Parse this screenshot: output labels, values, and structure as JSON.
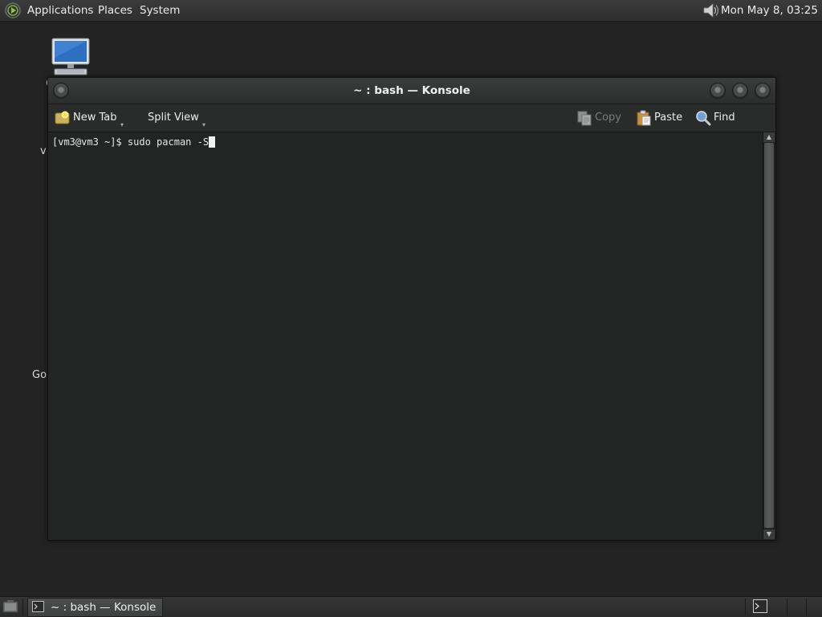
{
  "top_panel": {
    "menus": [
      "Applications",
      "Places",
      "System"
    ],
    "clock": "Mon May  8, 03:25"
  },
  "desktop": {
    "icon_partial_labels": [
      "C",
      "vi",
      "Go"
    ]
  },
  "window": {
    "title": "~ : bash — Konsole",
    "toolbar": {
      "new_tab": "New Tab",
      "split_view": "Split View",
      "copy": "Copy",
      "paste": "Paste",
      "find": "Find"
    },
    "terminal": {
      "prompt": "[vm3@vm3 ~]$ ",
      "command": "sudo pacman -S"
    }
  },
  "taskbar": {
    "tasks": [
      {
        "label": "~ : bash — Konsole"
      }
    ]
  },
  "colors": {
    "desktop_bg": "#222322",
    "terminal_bg": "#232525",
    "panel_bg": "#2d2e2d"
  }
}
